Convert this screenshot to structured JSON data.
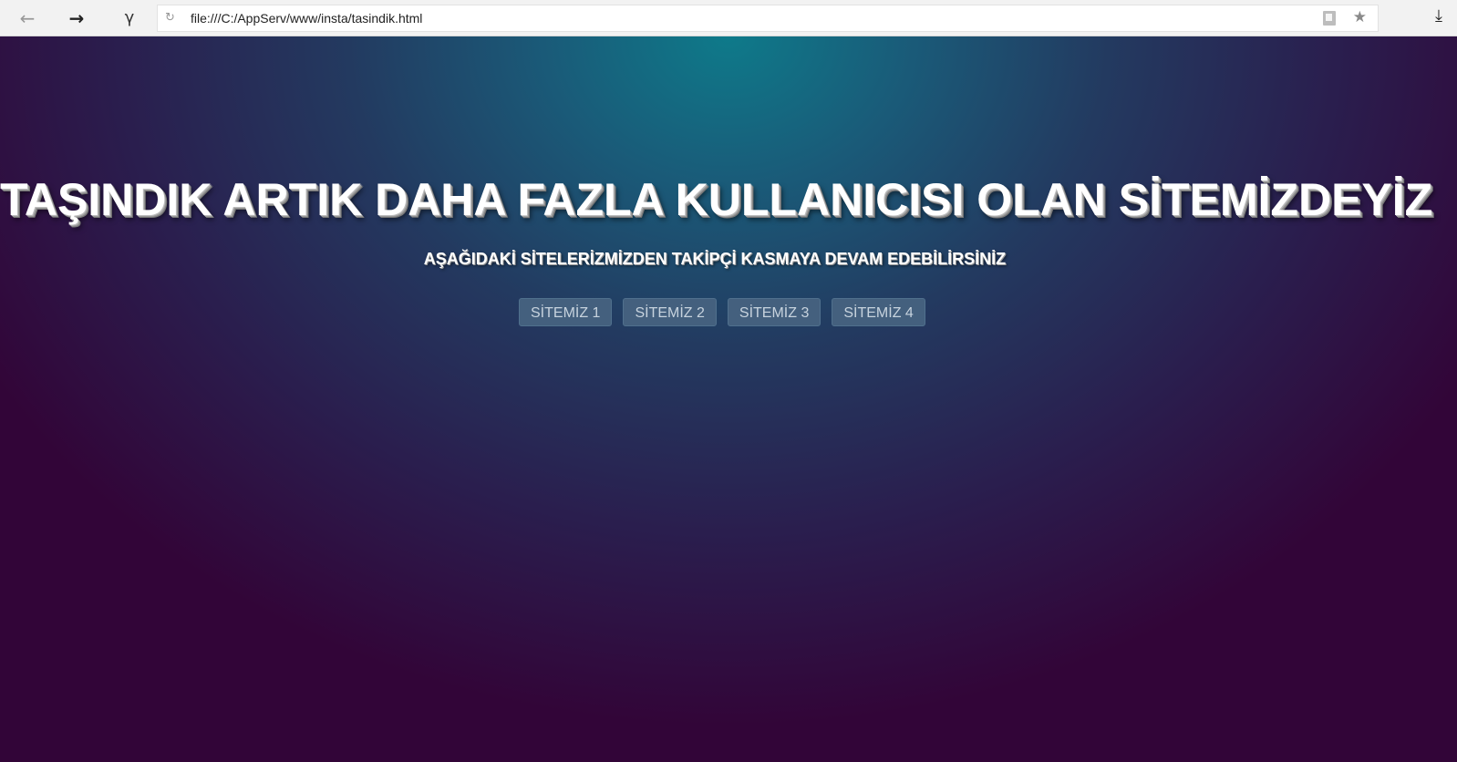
{
  "browser": {
    "back_icon": "arrow-left-icon",
    "forward_icon": "arrow-right-icon",
    "extension_icon": "gamma-icon",
    "reload_icon": "reload-icon",
    "url": "file:///C:/AppServ/www/insta/tasindik.html",
    "page_icon": "page-icon",
    "bookmark_icon": "star-icon",
    "download_icon": "download-icon"
  },
  "main": {
    "headline": "TAŞINDIK ARTIK DAHA FAZLA KULLANICISI OLAN SİTEMİZDEYİZ",
    "subline": "AŞAĞIDAKİ SİTELERİZMİZDEN TAKİPÇİ KASMAYA DEVAM EDEBİLİRSİNİZ",
    "buttons": [
      {
        "label": "SİTEMİZ 1"
      },
      {
        "label": "SİTEMİZ 2"
      },
      {
        "label": "SİTEMİZ 3"
      },
      {
        "label": "SİTEMİZ 4"
      }
    ]
  },
  "colors": {
    "background_center": "#0e7a8a",
    "background_edge": "#320538",
    "button_bg": "#44607e",
    "button_text": "#c7d3de",
    "text": "#ffffff"
  }
}
